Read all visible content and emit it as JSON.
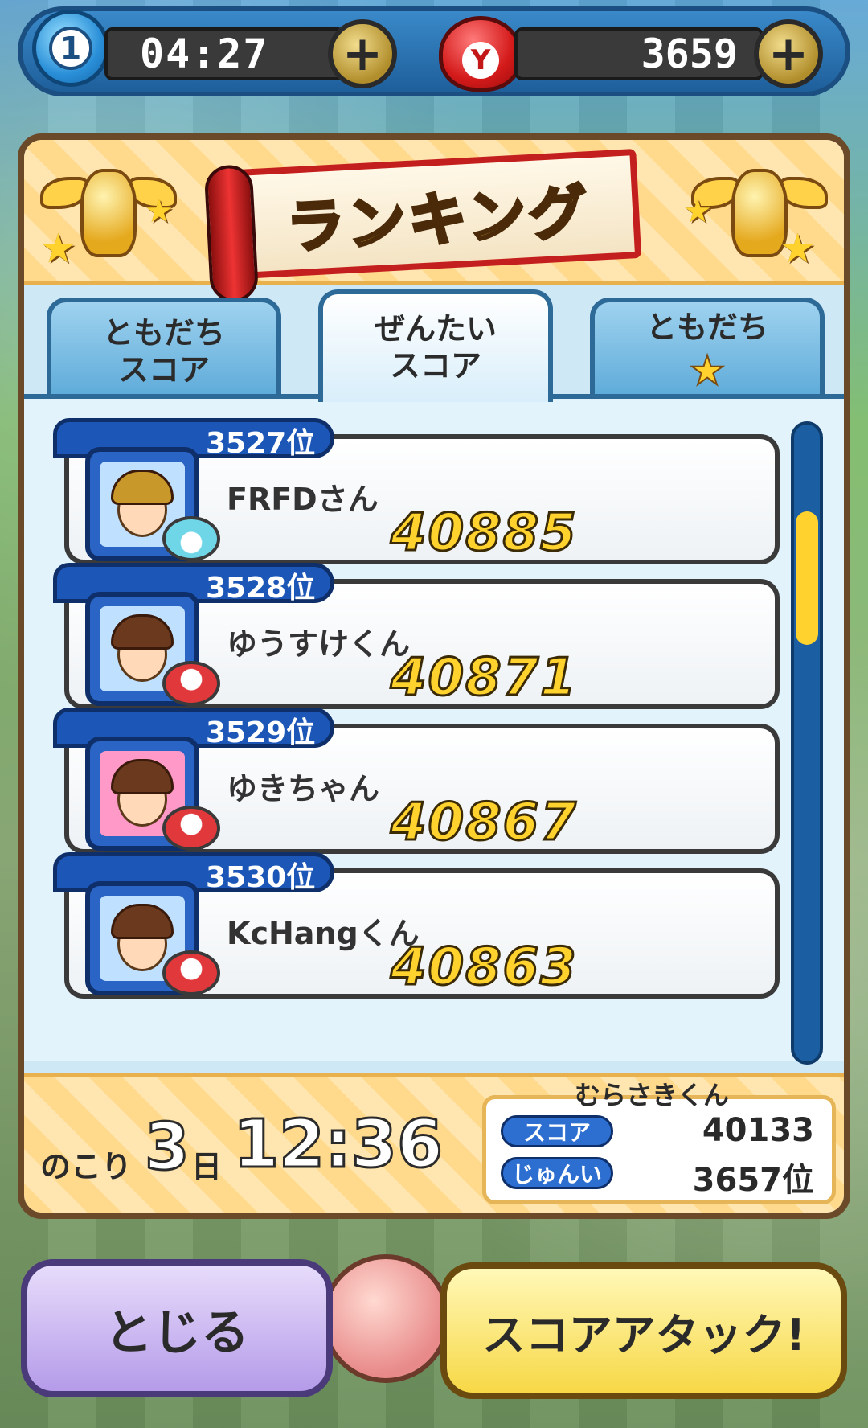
{
  "topbar": {
    "stamina_count": "1",
    "stamina_timer": "04:27",
    "money_icon_letter": "Y",
    "money_amount": "3659",
    "plus_label": "+"
  },
  "panel": {
    "title": "ランキング",
    "tabs": [
      {
        "label_line1": "ともだち",
        "label_line2": "スコア"
      },
      {
        "label_line1": "ぜんたい",
        "label_line2": "スコア"
      },
      {
        "label_line1": "ともだち",
        "label_line2": "★"
      }
    ],
    "active_tab": 1,
    "rows": [
      {
        "rank": "3527位",
        "name": "FRFDさん",
        "score": "40885"
      },
      {
        "rank": "3528位",
        "name": "ゆうすけくん",
        "score": "40871"
      },
      {
        "rank": "3529位",
        "name": "ゆきちゃん",
        "score": "40867"
      },
      {
        "rank": "3530位",
        "name": "KcHangくん",
        "score": "40863"
      }
    ],
    "footer": {
      "remain_label": "のこり",
      "remain_days": "3",
      "remain_day_unit": "日",
      "remain_time": "12:36",
      "me_name": "むらさきくん",
      "score_label": "スコア",
      "score_value": "40133",
      "rank_label": "じゅんい",
      "rank_value": "3657位"
    }
  },
  "buttons": {
    "close_label": "とじる",
    "attack_label": "スコアアタック!"
  }
}
